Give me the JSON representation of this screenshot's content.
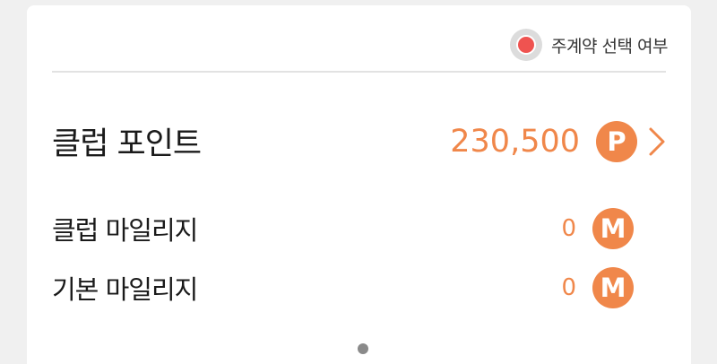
{
  "primary_toggle": {
    "label": "주계약 선택 여부",
    "state": "selected",
    "color": "#ef5350"
  },
  "club_points": {
    "label": "클럽 포인트",
    "amount": "230,500",
    "badge": "P",
    "icon": "chevron-right-icon"
  },
  "club_mileage": {
    "label": "클럽 마일리지",
    "amount": "0",
    "badge": "M"
  },
  "basic_mileage": {
    "label": "기본 마일리지",
    "amount": "0",
    "badge": "M"
  },
  "pager": {
    "total": 1,
    "current": 1
  },
  "colors": {
    "accent": "#f0874a",
    "text": "#1a1a1a",
    "background": "#f0f0f0",
    "card": "#ffffff"
  }
}
